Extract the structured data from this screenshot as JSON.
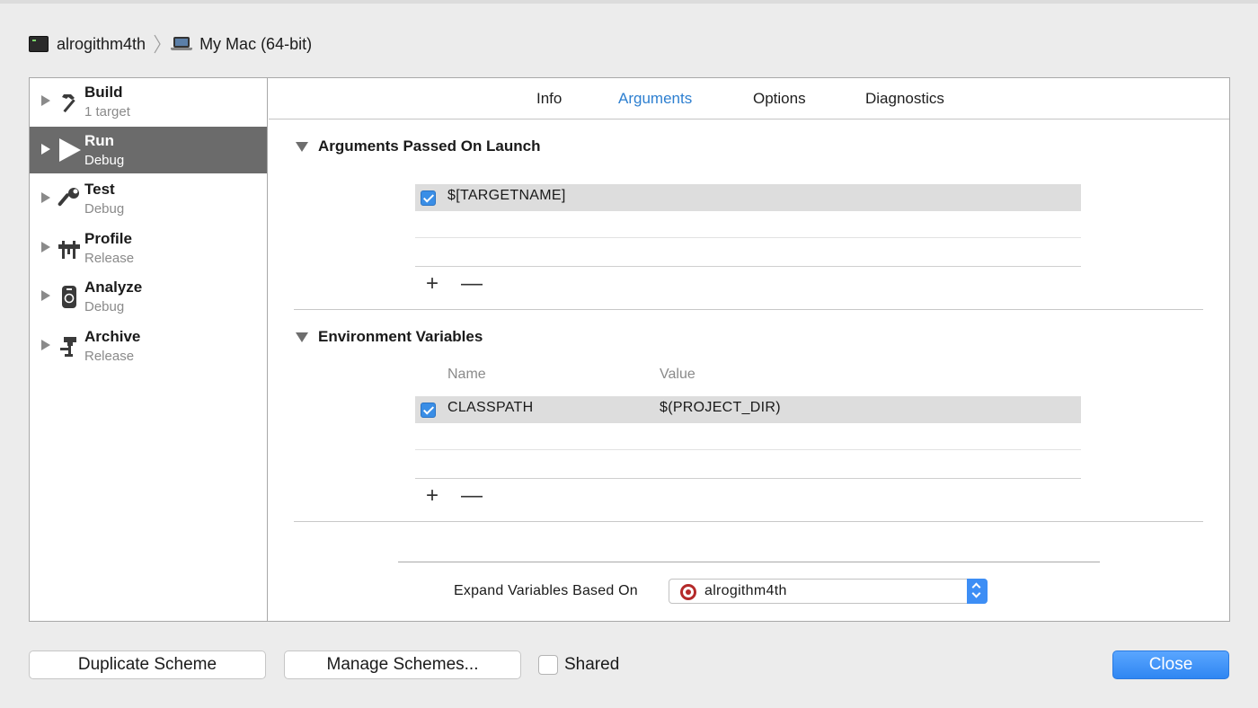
{
  "breadcrumb": {
    "project": "alrogithm4th",
    "destination": "My Mac (64-bit)"
  },
  "sidebar": {
    "items": [
      {
        "title": "Build",
        "subtitle": "1 target",
        "icon": "hammer-icon"
      },
      {
        "title": "Run",
        "subtitle": "Debug",
        "icon": "play-icon"
      },
      {
        "title": "Test",
        "subtitle": "Debug",
        "icon": "wrench-icon"
      },
      {
        "title": "Profile",
        "subtitle": "Release",
        "icon": "gauge-icon"
      },
      {
        "title": "Analyze",
        "subtitle": "Debug",
        "icon": "analyze-icon"
      },
      {
        "title": "Archive",
        "subtitle": "Release",
        "icon": "archive-icon"
      }
    ],
    "selected": "Run"
  },
  "tabs": {
    "info": "Info",
    "arguments": "Arguments",
    "options": "Options",
    "diagnostics": "Diagnostics",
    "active": "Arguments"
  },
  "arguments": {
    "title": "Arguments Passed On Launch",
    "rows": [
      {
        "enabled": true,
        "value": "$[TARGETNAME]"
      }
    ],
    "add": "+",
    "remove": "—"
  },
  "environment": {
    "title": "Environment Variables",
    "col_name": "Name",
    "col_value": "Value",
    "rows": [
      {
        "enabled": true,
        "name": "CLASSPATH",
        "value": "$(PROJECT_DIR)"
      }
    ],
    "add": "+",
    "remove": "—"
  },
  "expand": {
    "label": "Expand Variables Based On",
    "selected": "alrogithm4th"
  },
  "footer": {
    "duplicate": "Duplicate Scheme",
    "manage": "Manage Schemes...",
    "shared": "Shared",
    "shared_checked": false,
    "close": "Close"
  },
  "colors": {
    "accent": "#2d7fd0",
    "selected_row": "#6b6b6b",
    "close_button": "#3d8ef5"
  }
}
